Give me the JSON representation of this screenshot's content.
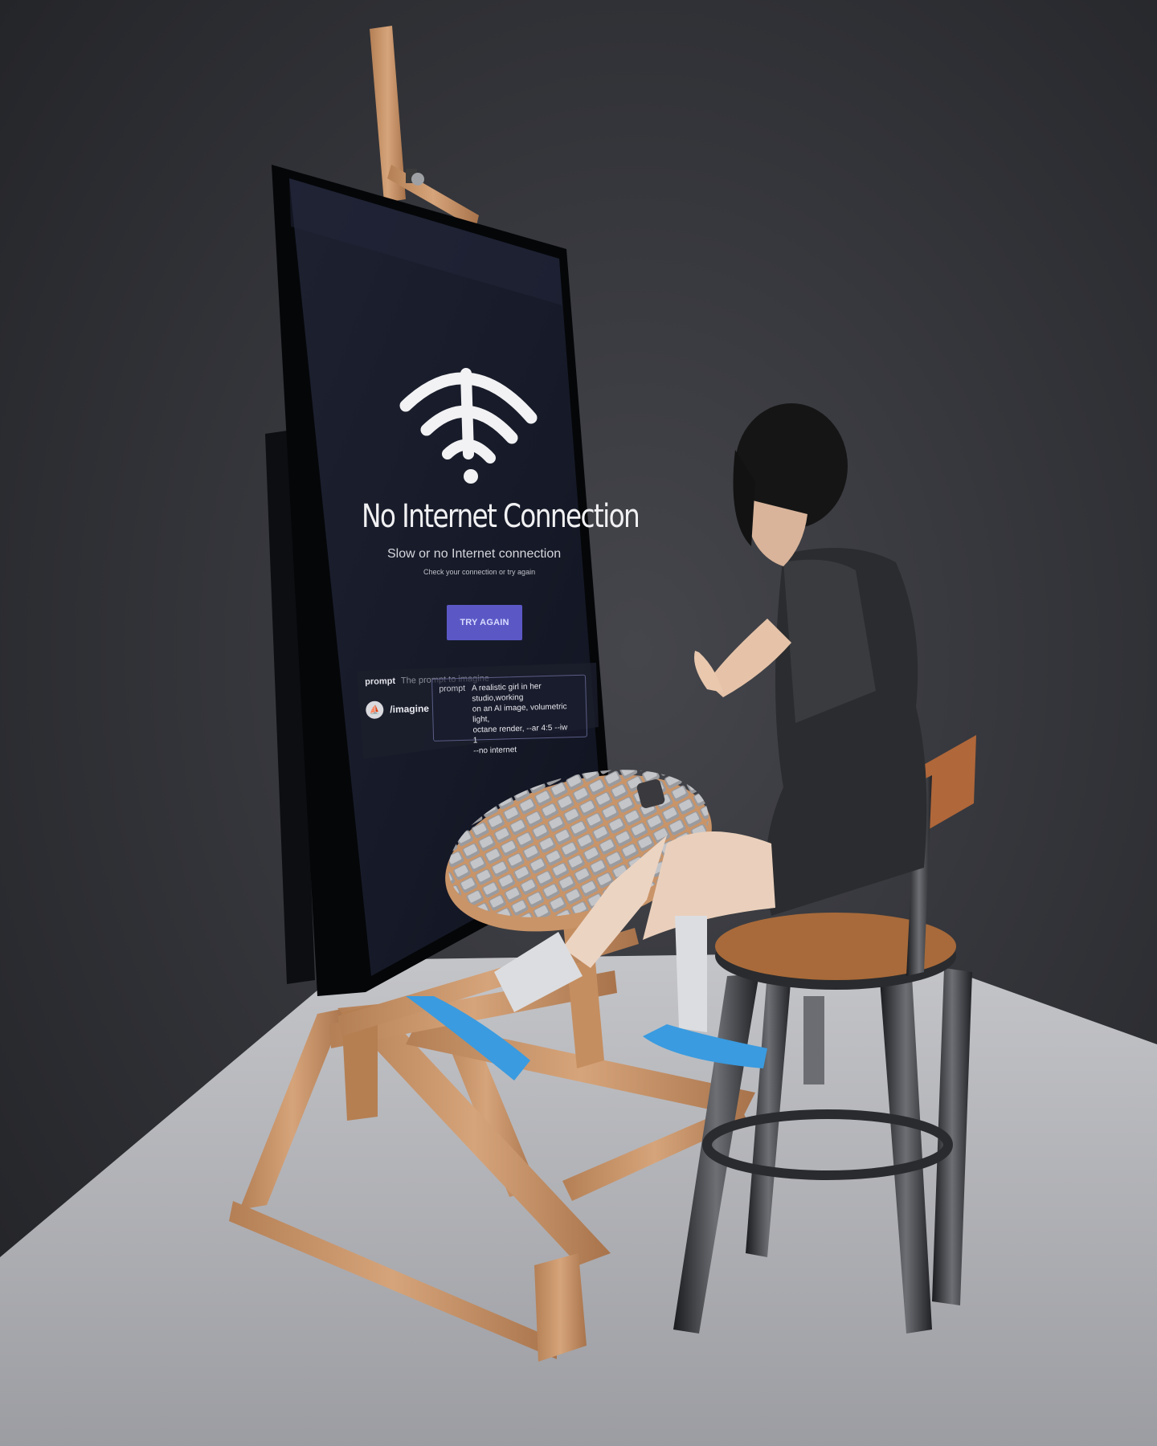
{
  "screen": {
    "title": "No Internet Connection",
    "subtitle": "Slow or no Internet connection",
    "hint": "Check your connection or try again",
    "button_label": "TRY AGAIN"
  },
  "prompt_bar": {
    "key": "prompt",
    "placeholder": "The prompt to imagine"
  },
  "command": {
    "name": "/imagine",
    "field_label": "prompt",
    "value": "A realistic girl in her studio,working\non an AI image, volumetric light,\noctane render, --ar 4:5 --iw 1\n--no internet"
  },
  "colors": {
    "button": "#5b58c6",
    "wall": "#2e2f34",
    "floor": "#b8b9bd",
    "wood": "#c99468",
    "sneaker": "#3a9be0"
  },
  "icons": {
    "wifi": "wifi-off-icon",
    "bot": "discord-bot-icon"
  }
}
